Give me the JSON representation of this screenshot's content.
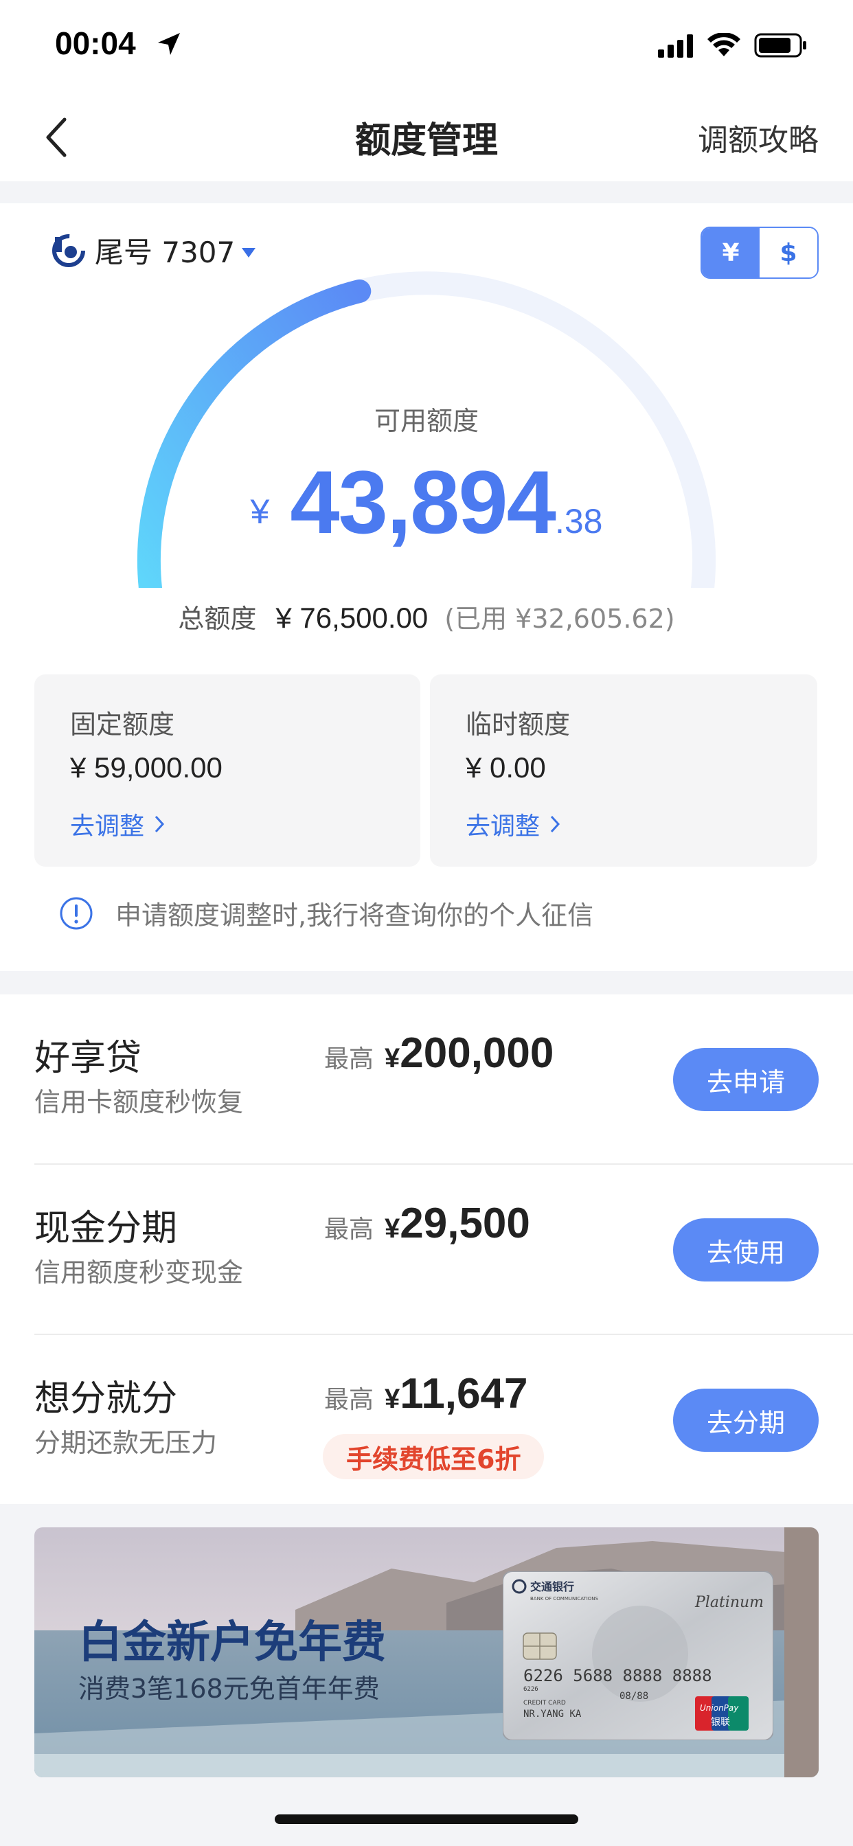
{
  "status_bar": {
    "time": "00:04"
  },
  "nav": {
    "title": "额度管理",
    "right_link": "调额攻略"
  },
  "account": {
    "card_tail": "尾号 7307"
  },
  "currency_toggle": {
    "rmb": "¥",
    "usd": "$",
    "active": "rmb"
  },
  "available": {
    "label": "可用额度",
    "symbol": "¥",
    "integer": "43,894",
    "decimal": ".38",
    "used_fraction": 0.43
  },
  "total": {
    "label": "总额度",
    "value": "¥ 76,500.00",
    "used": "(已用 ¥32,605.62)"
  },
  "fixed_limit": {
    "title": "固定额度",
    "value": "¥ 59,000.00",
    "link": "去调整"
  },
  "temp_limit": {
    "title": "临时额度",
    "value": "¥ 0.00",
    "link": "去调整"
  },
  "notice": "申请额度调整时,我行将查询你的个人征信",
  "products": [
    {
      "name": "好享贷",
      "desc": "信用卡额度秒恢复",
      "max_label": "最高",
      "currency": "¥",
      "amount": "200,000",
      "button": "去申请"
    },
    {
      "name": "现金分期",
      "desc": "信用额度秒变现金",
      "max_label": "最高",
      "currency": "¥",
      "amount": "29,500",
      "button": "去使用"
    },
    {
      "name": "想分就分",
      "desc": "分期还款无压力",
      "max_label": "最高",
      "currency": "¥",
      "amount": "11,647",
      "button": "去分期",
      "badge": "手续费低至6折"
    }
  ],
  "banner": {
    "title": "白金新户免年费",
    "subtitle": "消费3笔168元免首年年费",
    "card": {
      "bank_name": "交通银行",
      "bank_name_en": "BANK OF COMMUNICATIONS",
      "tier": "Platinum",
      "number": "6226 5688 8888 8888",
      "prefix": "6226",
      "valid_thru": "08/88",
      "holder": "NR.YANG KA",
      "type": "CREDIT CARD",
      "network": "UnionPay",
      "network_cn": "银联"
    }
  },
  "colors": {
    "accent": "#5b8af5",
    "link": "#3b73e6",
    "gauge_start": "#5fd8fb",
    "gauge_end": "#5b8af5",
    "badge_red": "#e2452d"
  }
}
